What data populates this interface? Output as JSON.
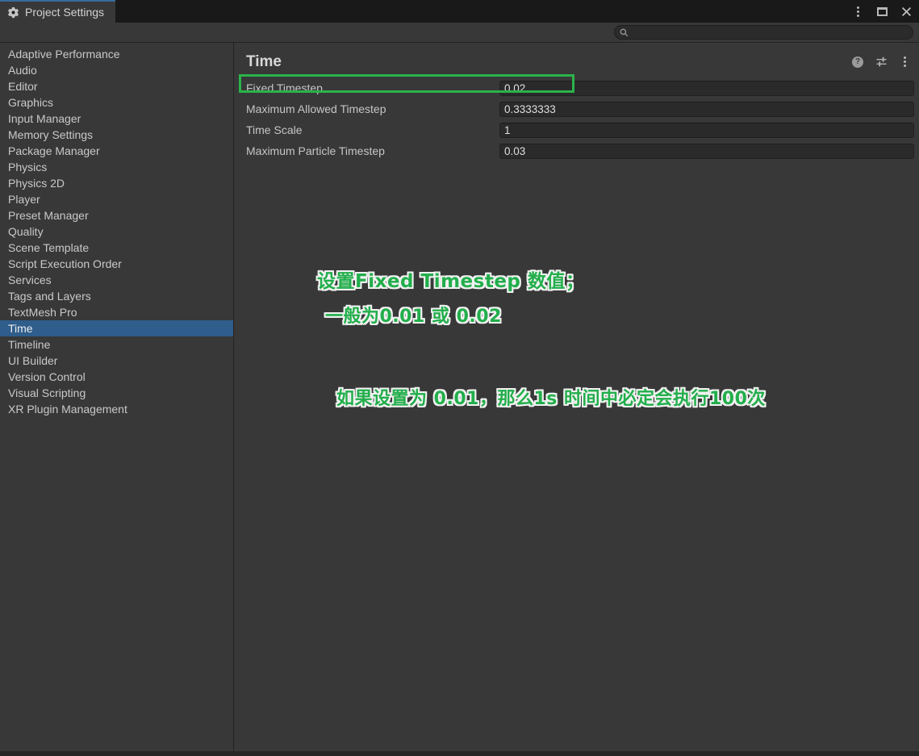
{
  "window": {
    "tab_title": "Project Settings"
  },
  "search": {
    "placeholder": ""
  },
  "sidebar": {
    "items": [
      {
        "label": "Adaptive Performance",
        "selected": false
      },
      {
        "label": "Audio",
        "selected": false
      },
      {
        "label": "Editor",
        "selected": false
      },
      {
        "label": "Graphics",
        "selected": false
      },
      {
        "label": "Input Manager",
        "selected": false
      },
      {
        "label": "Memory Settings",
        "selected": false
      },
      {
        "label": "Package Manager",
        "selected": false
      },
      {
        "label": "Physics",
        "selected": false
      },
      {
        "label": "Physics 2D",
        "selected": false
      },
      {
        "label": "Player",
        "selected": false
      },
      {
        "label": "Preset Manager",
        "selected": false
      },
      {
        "label": "Quality",
        "selected": false
      },
      {
        "label": "Scene Template",
        "selected": false
      },
      {
        "label": "Script Execution Order",
        "selected": false
      },
      {
        "label": "Services",
        "selected": false
      },
      {
        "label": "Tags and Layers",
        "selected": false
      },
      {
        "label": "TextMesh Pro",
        "selected": false
      },
      {
        "label": "Time",
        "selected": true
      },
      {
        "label": "Timeline",
        "selected": false
      },
      {
        "label": "UI Builder",
        "selected": false
      },
      {
        "label": "Version Control",
        "selected": false
      },
      {
        "label": "Visual Scripting",
        "selected": false
      },
      {
        "label": "XR Plugin Management",
        "selected": false
      }
    ]
  },
  "main": {
    "title": "Time",
    "fields": [
      {
        "label": "Fixed Timestep",
        "value": "0.02",
        "highlighted": true
      },
      {
        "label": "Maximum Allowed Timestep",
        "value": "0.3333333",
        "highlighted": false
      },
      {
        "label": "Time Scale",
        "value": "1",
        "highlighted": false
      },
      {
        "label": "Maximum Particle Timestep",
        "value": "0.03",
        "highlighted": false
      }
    ],
    "annotations": [
      "设置Fixed Timestep 数值；",
      "一般为0.01 或 0.02",
      "如果设置为 0.01，那么1s 时间中必定会执行100次"
    ]
  },
  "icons": {
    "help_glyph": "?",
    "tab_icon": "gear-icon",
    "search_icon": "search-icon",
    "header_icons": [
      "help-icon",
      "preset-sliders-icon",
      "kebab-menu-icon"
    ],
    "window_controls": [
      "kebab-menu-icon",
      "maximize-icon",
      "close-icon"
    ]
  },
  "colors": {
    "selection_blue": "#2F5D8C",
    "tab_accent_blue": "#3A6B9C",
    "annotation_green": "#22AE4B",
    "highlight_green": "#2BB34A",
    "panel_background": "#383838",
    "chrome_background": "#191919"
  }
}
